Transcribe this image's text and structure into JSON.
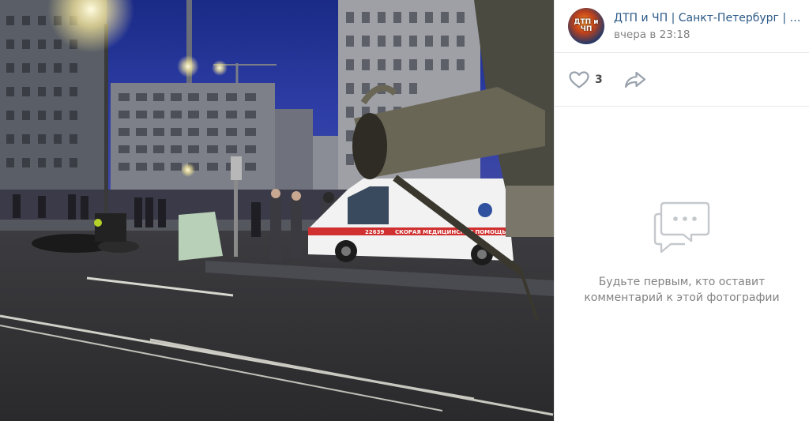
{
  "post": {
    "author": "ДТП и ЧП | Санкт-Петербург | Питер",
    "avatar_text": "ДТП и ЧП",
    "date": "вчера в 23:18"
  },
  "actions": {
    "likes_count": "3",
    "like_icon": "heart-icon",
    "share_icon": "share-arrow-icon"
  },
  "comments": {
    "empty_line1": "Будьте первым, кто оставит",
    "empty_line2": "комментарий к этой фотографии",
    "icon": "comments-bubble-icon"
  },
  "photo": {
    "ambulance_label": "СКОРАЯ МЕДИЦИНСКАЯ ПОМОЩЬ",
    "ambulance_number": "22639"
  },
  "colors": {
    "link": "#2a5885",
    "secondary_text": "#828282",
    "divider": "#e7e8ec",
    "icon": "#99a2ad",
    "icon_light": "#c4c8cc"
  }
}
